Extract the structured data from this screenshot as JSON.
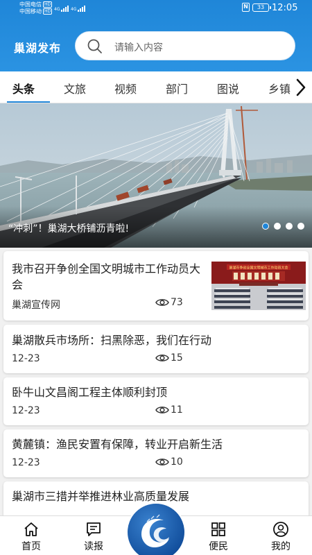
{
  "status_bar": {
    "carrier_1": "中国电信",
    "carrier_2": "中国移动",
    "hd_badge": "HD",
    "network_1": "4G",
    "network_2": "4G",
    "nfc": "N",
    "battery": "33",
    "time": "12:05"
  },
  "header": {
    "app_title": "巢湖发布",
    "search_placeholder": "请输入内容"
  },
  "tabs": {
    "items": [
      "头条",
      "文旅",
      "视频",
      "部门",
      "图说",
      "乡镇"
    ],
    "active_index": 0,
    "more_icon": "chevron-right-icon"
  },
  "banner": {
    "caption": "“冲刺”！巢湖大桥铺沥青啦!",
    "slide_count": 4,
    "active_slide": 0
  },
  "news": [
    {
      "title": "我市召开争创全国文明城市工作动员大会",
      "source": "巢湖宣传网",
      "views": "73",
      "has_thumbnail": true,
      "thumbnail_banner_text": "巢湖市争创全国文明城市工作动员大会"
    },
    {
      "title": "巢湖散兵市场所：扫黑除恶，我们在行动",
      "source": "12-23",
      "views": "15",
      "has_thumbnail": false
    },
    {
      "title": "卧牛山文昌阁工程主体顺利封顶",
      "source": "12-23",
      "views": "11",
      "has_thumbnail": false
    },
    {
      "title": "黄麓镇：渔民安置有保障，转业开启新生活",
      "source": "12-23",
      "views": "10",
      "has_thumbnail": false
    },
    {
      "title": "巢湖市三措并举推进林业高质量发展",
      "source": "",
      "views": "",
      "has_thumbnail": false
    }
  ],
  "bottom_nav": {
    "items": [
      {
        "label": "首页",
        "icon": "home-icon"
      },
      {
        "label": "读报",
        "icon": "newspaper-icon"
      },
      {
        "label": "便民",
        "icon": "grid-icon"
      },
      {
        "label": "我的",
        "icon": "user-icon"
      }
    ],
    "center_icon": "app-logo-icon"
  },
  "colors": {
    "brand": "#1f86d8",
    "header_bg": "#2b93e2",
    "text": "#222222"
  }
}
